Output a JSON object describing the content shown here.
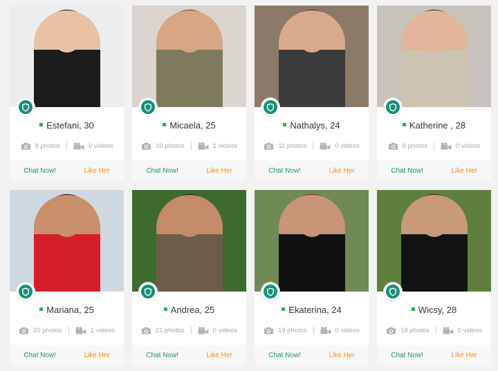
{
  "colors": {
    "accent_green": "#14917a",
    "online_green": "#2bb34a",
    "like_orange": "#f28c0f",
    "stat_gray": "#a6a6a6"
  },
  "icons": {
    "badge": "shield-icon",
    "photos": "camera-icon",
    "videos": "video-camera-icon"
  },
  "profiles": [
    {
      "name_age": "Estefani, 30",
      "photos": "8 photos",
      "videos": "0 videos",
      "chat_label": "Chat Now!",
      "like_label": "Like Her",
      "palette": {
        "bg": "#ededed",
        "hair": "#151515",
        "skin": "#e9c2a6",
        "top": "#1c1c1c"
      }
    },
    {
      "name_age": "Micaela, 25",
      "photos": "10 photos",
      "videos": "1 videos",
      "chat_label": "Chat Now!",
      "like_label": "Like Her",
      "palette": {
        "bg": "#d9d4ce",
        "hair": "#5a3b24",
        "skin": "#d8a585",
        "top": "#7d7a5e"
      }
    },
    {
      "name_age": "Nathalys, 24",
      "photos": "11 photos",
      "videos": "0 videos",
      "chat_label": "Chat Now!",
      "like_label": "Like Her",
      "palette": {
        "bg": "#8c7a68",
        "hair": "#3a2418",
        "skin": "#d9a98b",
        "top": "#3b3b3b"
      }
    },
    {
      "name_age": "Katherine , 28",
      "photos": "9 photos",
      "videos": "0 videos",
      "chat_label": "Chat Now!",
      "like_label": "Like Her",
      "palette": {
        "bg": "#c8c2bd",
        "hair": "#2b2017",
        "skin": "#e3b59a",
        "top": "#ccc4b0"
      }
    },
    {
      "name_age": "Mariana, 25",
      "photos": "20 photos",
      "videos": "1 videos",
      "chat_label": "Chat Now!",
      "like_label": "Like Her",
      "palette": {
        "bg": "#cfd8df",
        "hair": "#1a120c",
        "skin": "#c98f6b",
        "top": "#d61e2a"
      }
    },
    {
      "name_age": "Andrea, 25",
      "photos": "21 photos",
      "videos": "0 videos",
      "chat_label": "Chat Now!",
      "like_label": "Like Her",
      "palette": {
        "bg": "#3d6b2d",
        "hair": "#120d0a",
        "skin": "#c48c68",
        "top": "#6e5c48"
      }
    },
    {
      "name_age": "Ekaterina, 24",
      "photos": "19 photos",
      "videos": "0 videos",
      "chat_label": "Chat Now!",
      "like_label": "Like Her",
      "palette": {
        "bg": "#6f8a55",
        "hair": "#7a2a22",
        "skin": "#c99577",
        "top": "#111111"
      }
    },
    {
      "name_age": "Wicsy, 28",
      "photos": "18 photos",
      "videos": "0 videos",
      "chat_label": "Chat Now!",
      "like_label": "Like Her",
      "palette": {
        "bg": "#5e7f3e",
        "hair": "#2a1a10",
        "skin": "#c99a79",
        "top": "#121212"
      }
    }
  ]
}
